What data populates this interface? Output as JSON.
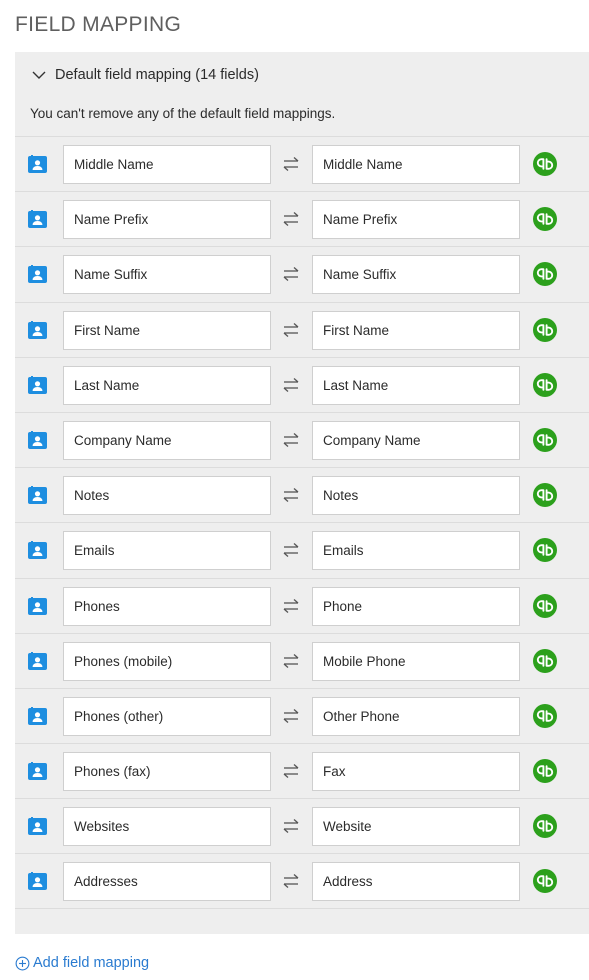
{
  "page": {
    "title": "FIELD MAPPING"
  },
  "panel": {
    "title": "Default field mapping (14 fields)",
    "notice": "You can't remove any of the default field mappings.",
    "expanded": true
  },
  "icons": {
    "source": "contact-card-icon",
    "swap": "swap-arrows-icon",
    "target": "quickbooks-icon",
    "add": "plus-circle-icon"
  },
  "colors": {
    "contact_icon": "#1e8ee0",
    "quickbooks": "#2ca01c",
    "link": "#2a7bd0",
    "panel_bg": "#eeeeee"
  },
  "mappings": [
    {
      "source": "Middle Name",
      "target": "Middle Name"
    },
    {
      "source": "Name Prefix",
      "target": "Name Prefix"
    },
    {
      "source": "Name Suffix",
      "target": "Name Suffix"
    },
    {
      "source": "First Name",
      "target": "First Name"
    },
    {
      "source": "Last Name",
      "target": "Last Name"
    },
    {
      "source": "Company Name",
      "target": "Company Name"
    },
    {
      "source": "Notes",
      "target": "Notes"
    },
    {
      "source": "Emails",
      "target": "Emails"
    },
    {
      "source": "Phones",
      "target": "Phone"
    },
    {
      "source": "Phones (mobile)",
      "target": "Mobile Phone"
    },
    {
      "source": "Phones (other)",
      "target": "Other Phone"
    },
    {
      "source": "Phones (fax)",
      "target": "Fax"
    },
    {
      "source": "Websites",
      "target": "Website"
    },
    {
      "source": "Addresses",
      "target": "Address"
    }
  ],
  "footer": {
    "add_label": "Add field mapping"
  }
}
